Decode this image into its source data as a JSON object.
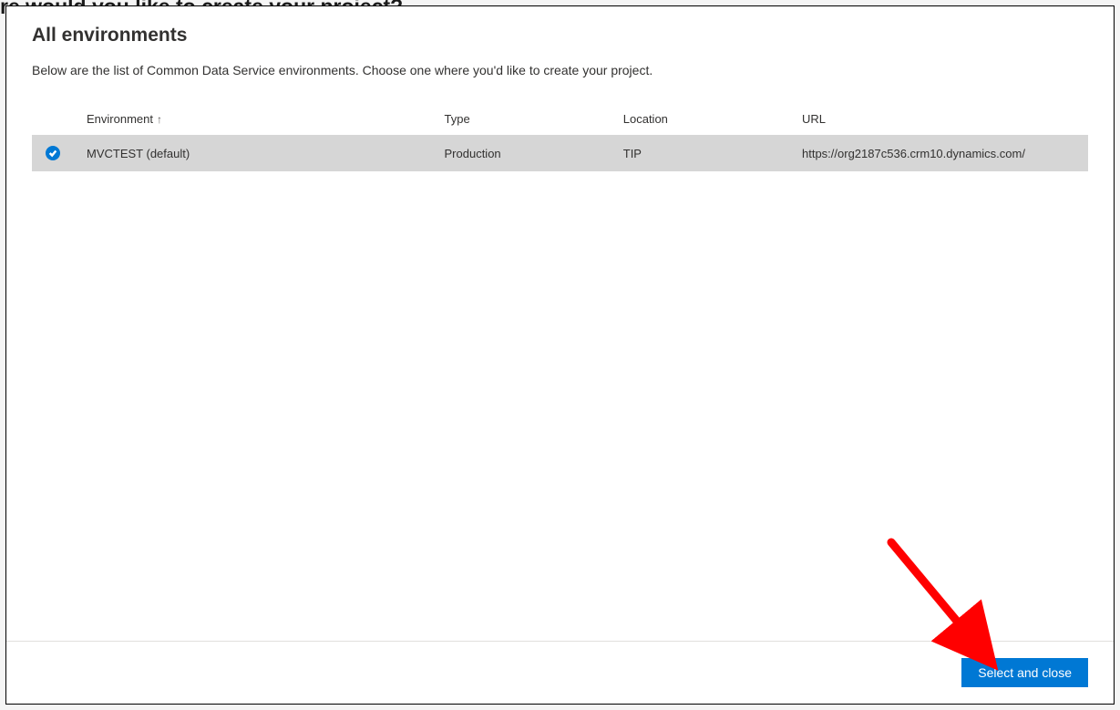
{
  "backdrop_text": "re would you like to create your project?",
  "dialog": {
    "title": "All environments",
    "description": "Below are the list of Common Data Service environments. Choose one where you'd like to create your project."
  },
  "table": {
    "columns": {
      "environment": "Environment",
      "type": "Type",
      "location": "Location",
      "url": "URL"
    },
    "rows": [
      {
        "selected": true,
        "environment": "MVCTEST (default)",
        "type": "Production",
        "location": "TIP",
        "url": "https://org2187c536.crm10.dynamics.com/"
      }
    ]
  },
  "footer": {
    "primary_button": "Select and close"
  },
  "colors": {
    "primary": "#0078d4",
    "annotation": "#ff0000"
  }
}
